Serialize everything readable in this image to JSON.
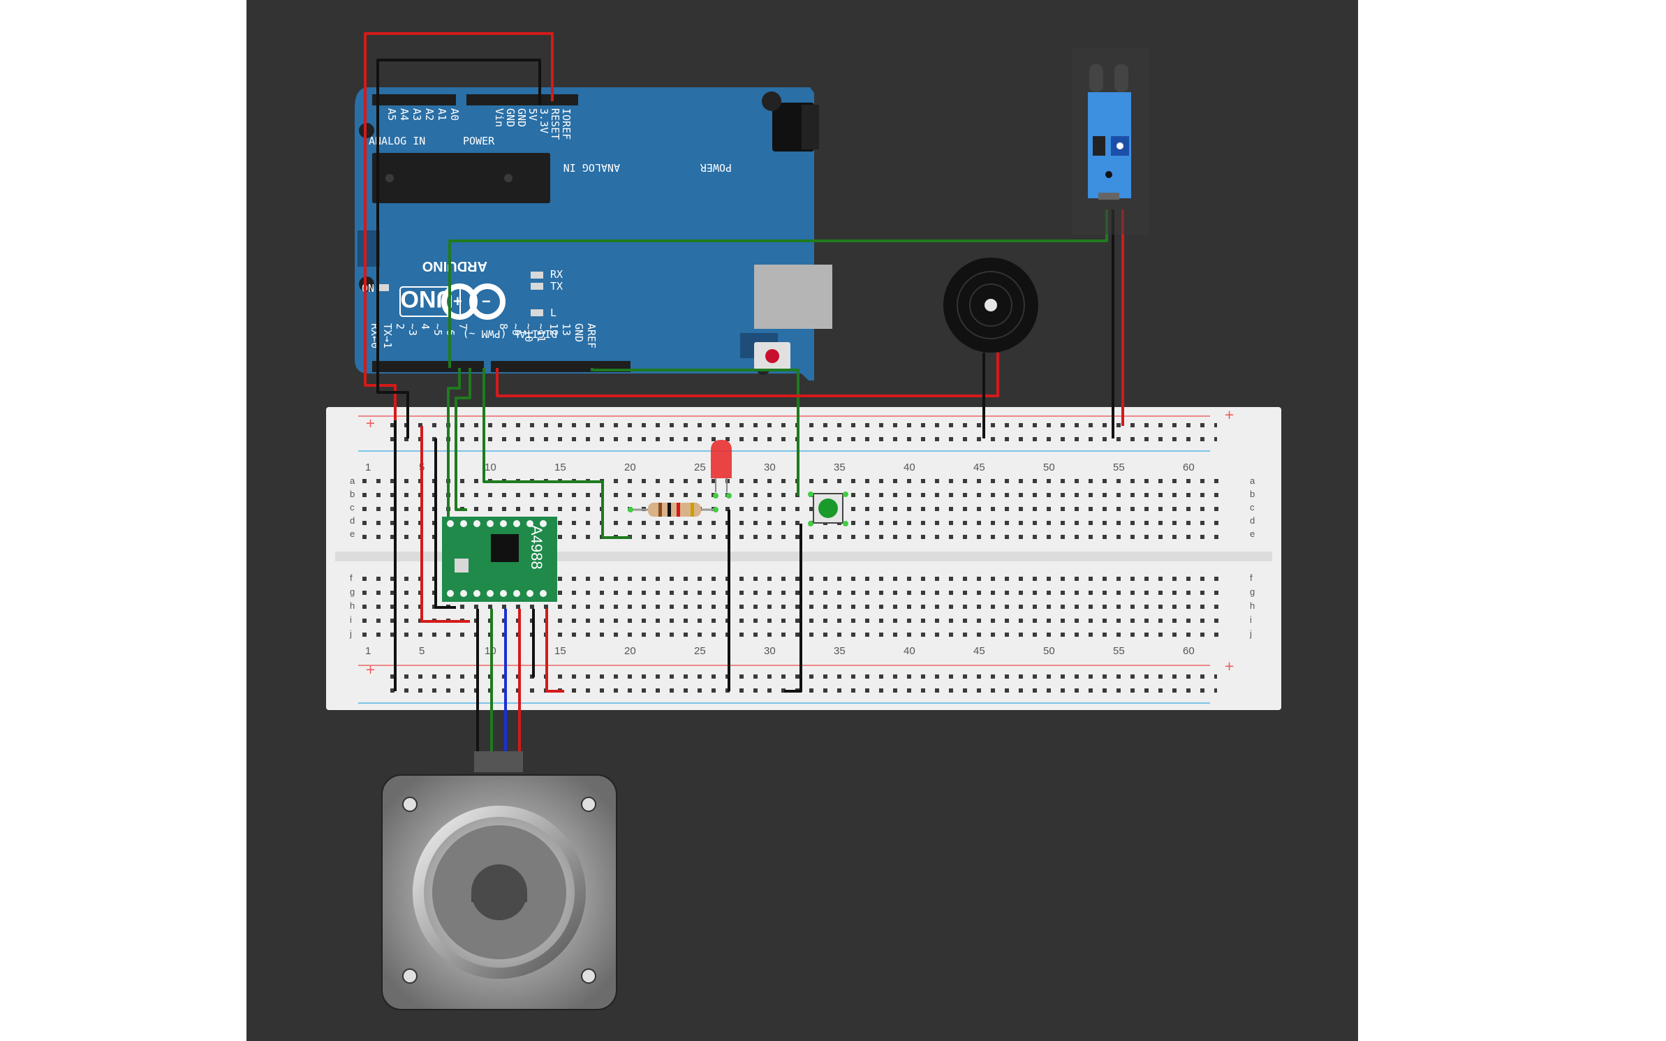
{
  "canvas": {
    "background": "#333333",
    "page_background": "#ffffff"
  },
  "colors": {
    "wire_red": "#d41a1a",
    "wire_black": "#111111",
    "wire_green": "#1f7a1f",
    "wire_blue": "#1a2fd4",
    "arduino_blue": "#2a6fa6",
    "driver_green": "#1f8a4a",
    "sensor_blue": "#3d8fe0",
    "breadboard": "#eeeeee",
    "led_red": "#e83030",
    "button_green": "#1a9a2a"
  },
  "arduino": {
    "board_name": "UNO",
    "brand": "ARDUINO",
    "power_pins": [
      "IOREF",
      "RESET",
      "3.3V",
      "5V",
      "GND",
      "GND",
      "Vin"
    ],
    "analog_pins": [
      "A0",
      "A1",
      "A2",
      "A3",
      "A4",
      "A5"
    ],
    "power_header": "POWER",
    "analog_header": "ANALOG IN",
    "digital_header": "DIGITAL (PWM ~)",
    "digital_pins": [
      "RX←0",
      "TX→1",
      "2",
      "~3",
      "4",
      "~5",
      "~6",
      "7",
      "8",
      "~9",
      "~10",
      "~11",
      "12",
      "13",
      "GND",
      "AREF"
    ],
    "labels": {
      "tx": "TX",
      "rx": "RX",
      "on": "ON",
      "l": "L"
    }
  },
  "driver": {
    "label": "A4988"
  },
  "breadboard": {
    "column_numbers": [
      "1",
      "5",
      "10",
      "15",
      "20",
      "25",
      "30",
      "35",
      "40",
      "45",
      "50",
      "55",
      "60"
    ],
    "rows_top": [
      "a",
      "b",
      "c",
      "d",
      "e"
    ],
    "rows_bottom": [
      "f",
      "g",
      "h",
      "i",
      "j"
    ],
    "plus_sign": "+",
    "minus_sign": "-"
  },
  "components": {
    "led": "led",
    "resistor": "resistor",
    "pushbutton": "pushbutton",
    "buzzer": "buzzer",
    "ir_sensor": "ir-sensor",
    "stepper_motor": "stepper-motor"
  }
}
